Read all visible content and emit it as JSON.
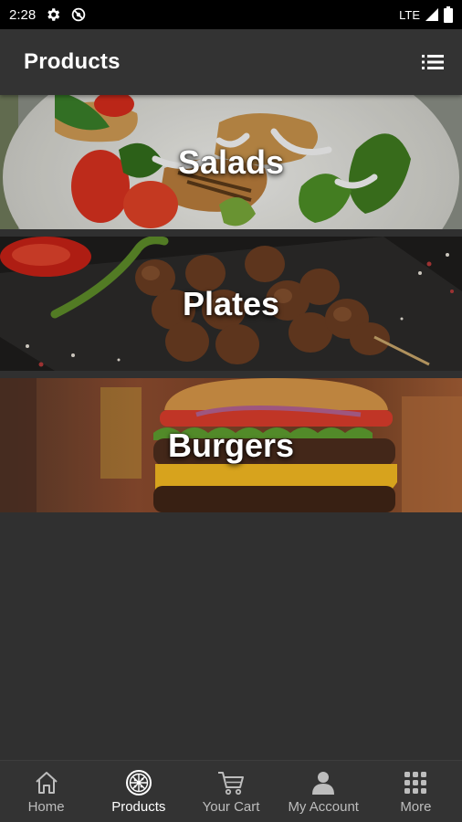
{
  "status_bar": {
    "time": "2:28",
    "network": "LTE",
    "icons": [
      "settings-icon",
      "sync-icon",
      "signal-icon",
      "battery-icon"
    ]
  },
  "app_bar": {
    "title": "Products",
    "action_icon": "list-view-icon"
  },
  "categories": [
    {
      "label": "Salads",
      "image": "salad-photo"
    },
    {
      "label": "Plates",
      "image": "skewer-plate-photo"
    },
    {
      "label": "Burgers",
      "image": "burger-photo"
    }
  ],
  "bottom_nav": {
    "items": [
      {
        "label": "Home",
        "icon": "home-icon",
        "active": false
      },
      {
        "label": "Products",
        "icon": "pizza-icon",
        "active": true
      },
      {
        "label": "Your Cart",
        "icon": "cart-icon",
        "active": false
      },
      {
        "label": "My Account",
        "icon": "account-icon",
        "active": false
      },
      {
        "label": "More",
        "icon": "grid-icon",
        "active": false
      }
    ]
  },
  "colors": {
    "background": "#303030",
    "app_bar": "#333333",
    "status_bar": "#000000",
    "nav_inactive": "#bdbdbd",
    "nav_active": "#ffffff"
  }
}
